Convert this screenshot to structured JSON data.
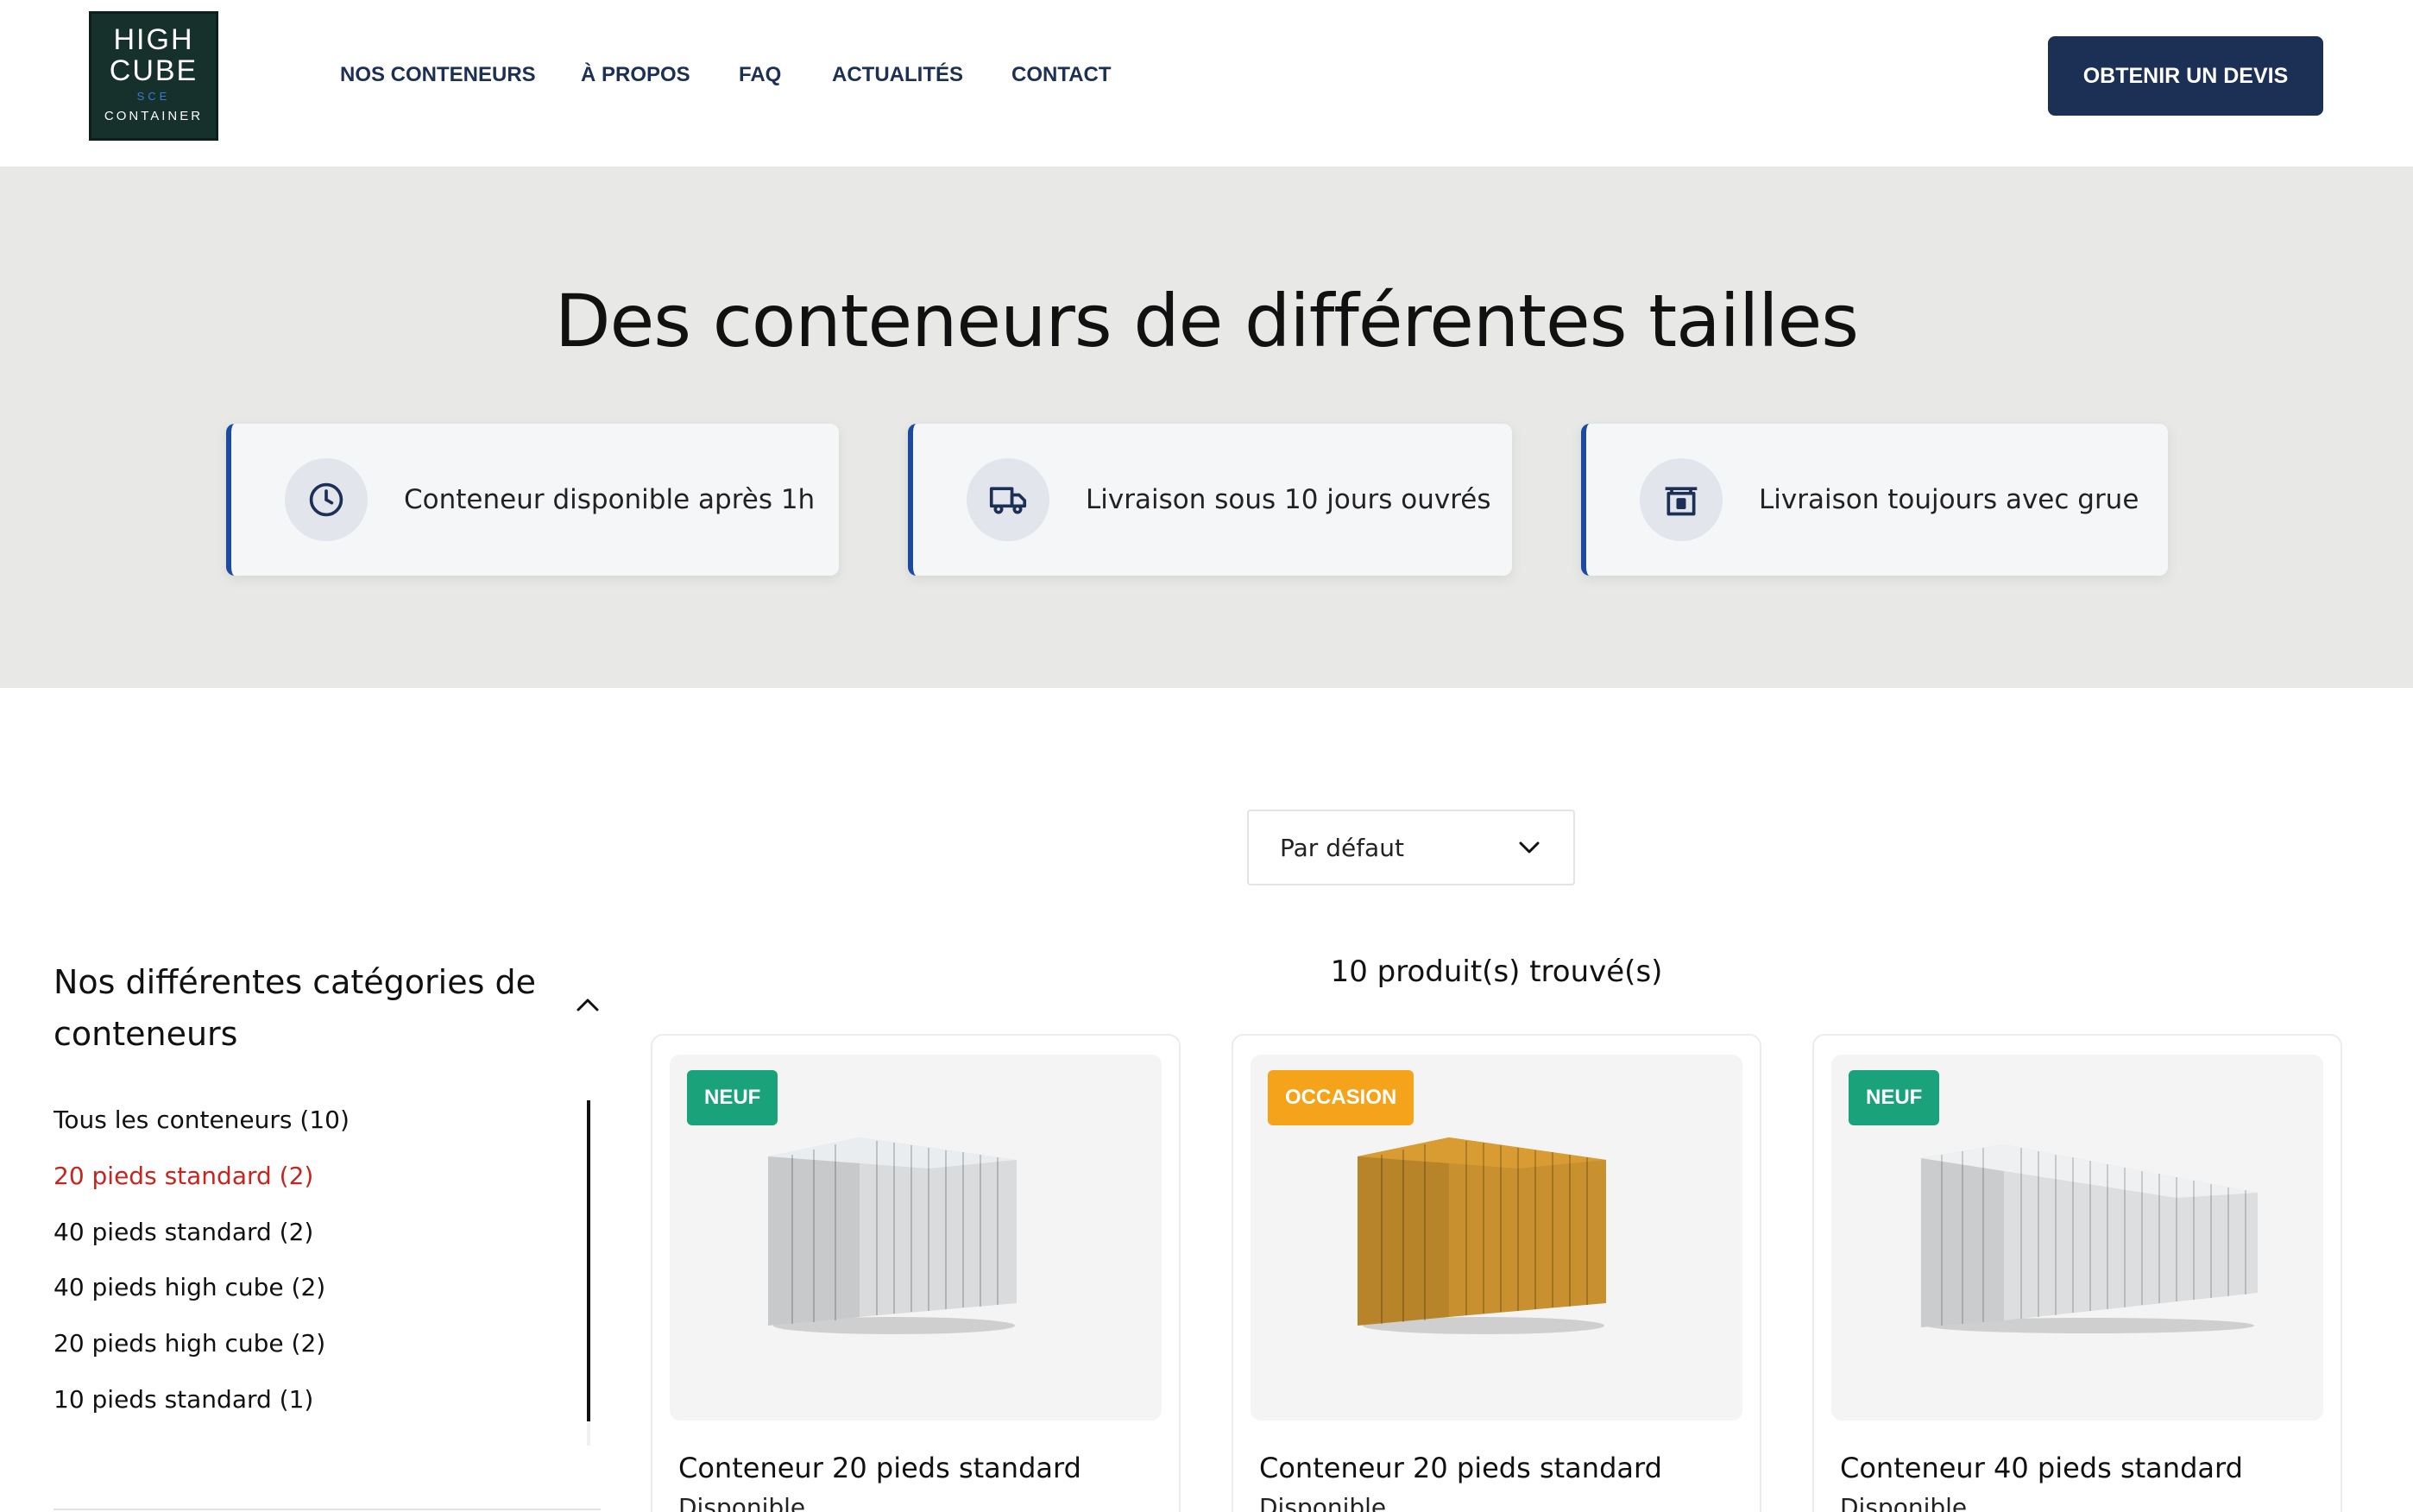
{
  "logo": {
    "line1": "HIGH",
    "line2": "CUBE",
    "line3": "SCE",
    "line4": "CONTAINER"
  },
  "nav": {
    "items": [
      {
        "label": "NOS CONTENEURS",
        "active": true
      },
      {
        "label": "À PROPOS",
        "active": false
      },
      {
        "label": "FAQ",
        "active": false
      },
      {
        "label": "ACTUALITÉS",
        "active": false
      },
      {
        "label": "CONTACT",
        "active": false
      }
    ],
    "cta_label": "OBTENIR UN DEVIS"
  },
  "hero": {
    "title": "Des conteneurs de différentes tailles",
    "features": [
      {
        "icon": "clock-icon",
        "text": "Conteneur disponible après 1h"
      },
      {
        "icon": "truck-icon",
        "text": "Livraison sous 10 jours ouvrés"
      },
      {
        "icon": "crane-container-icon",
        "text": "Livraison toujours avec grue"
      }
    ]
  },
  "sort": {
    "selected": "Par défaut"
  },
  "sidebar": {
    "title": "Nos différentes catégories de conteneurs",
    "categories": [
      {
        "label": "Tous les conteneurs (10)",
        "active": false
      },
      {
        "label": "20 pieds standard (2)",
        "active": true
      },
      {
        "label": "40 pieds standard (2)",
        "active": false
      },
      {
        "label": "40 pieds high cube (2)",
        "active": false
      },
      {
        "label": "20 pieds high cube (2)",
        "active": false
      },
      {
        "label": "10 pieds standard (1)",
        "active": false
      }
    ]
  },
  "results": {
    "count_label": "10 produit(s) trouvé(s)"
  },
  "products": [
    {
      "badge": "NEUF",
      "badge_type": "new",
      "title": "Conteneur 20 pieds standard",
      "status": "Disponible",
      "color": "#d9dbdd",
      "length": "20"
    },
    {
      "badge": "OCCASION",
      "badge_type": "used",
      "title": "Conteneur 20 pieds standard",
      "status": "Disponible",
      "color": "#c8902e",
      "length": "20"
    },
    {
      "badge": "NEUF",
      "badge_type": "new",
      "title": "Conteneur 40 pieds standard",
      "status": "Disponible",
      "color": "#dcdee0",
      "length": "40"
    }
  ],
  "colors": {
    "navy": "#1c2f55",
    "accent_red": "#c8241d",
    "badge_new": "#1aa37a",
    "badge_used": "#f5a31a",
    "feature_border": "#1c4aa0"
  }
}
